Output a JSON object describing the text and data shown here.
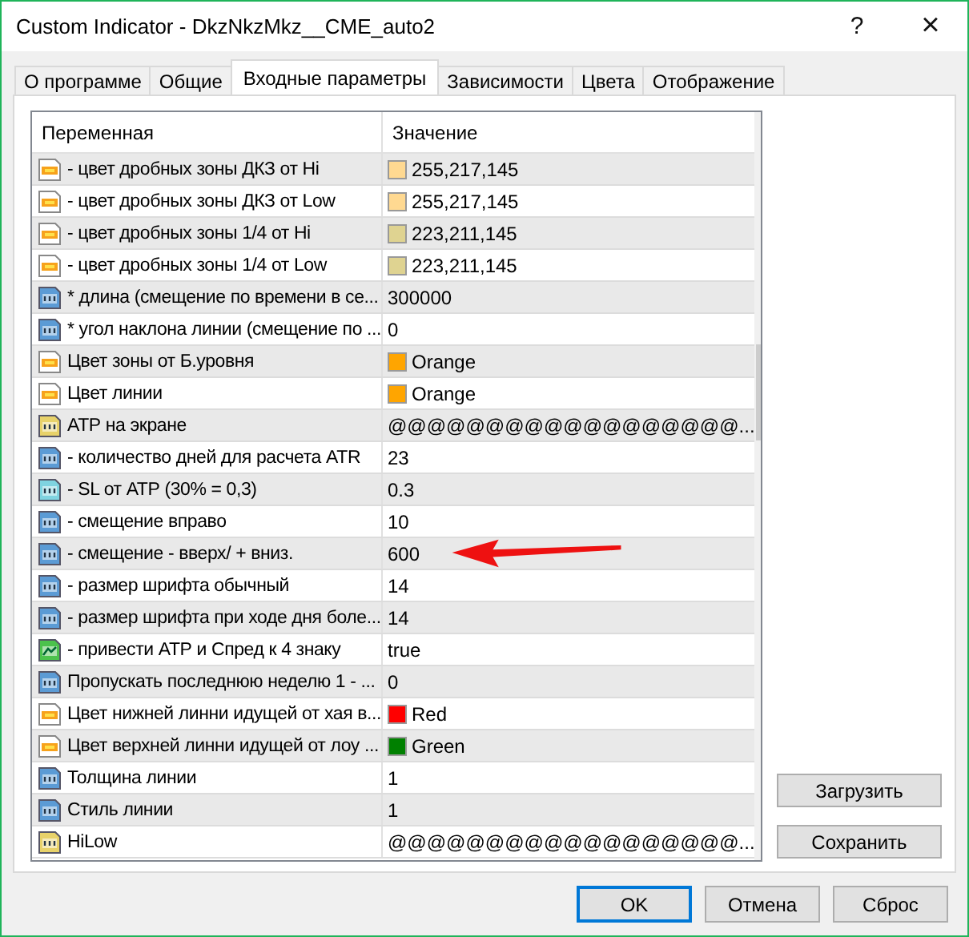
{
  "window": {
    "title": "Custom Indicator - DkzNkzMkz__CME_auto2",
    "help": "?",
    "close": "×"
  },
  "tabs": [
    {
      "label": "О программе",
      "selected": false
    },
    {
      "label": "Общие",
      "selected": false
    },
    {
      "label": "Входные параметры",
      "selected": true
    },
    {
      "label": "Зависимости",
      "selected": false
    },
    {
      "label": "Цвета",
      "selected": false
    },
    {
      "label": "Отображение",
      "selected": false
    }
  ],
  "table": {
    "columns": [
      "Переменная",
      "Значение"
    ],
    "rows": [
      {
        "kind": "color",
        "name": "- цвет дробных зоны ДКЗ от Hi",
        "value": "255,217,145",
        "color": "#ffd991",
        "marked": false
      },
      {
        "kind": "color",
        "name": "- цвет дробных зоны ДКЗ от Low",
        "value": "255,217,145",
        "color": "#ffd991",
        "marked": false
      },
      {
        "kind": "color",
        "name": "- цвет дробных зоны 1/4 от Hi",
        "value": "223,211,145",
        "color": "#dfd391",
        "marked": false
      },
      {
        "kind": "color",
        "name": "- цвет дробных зоны 1/4 от Low",
        "value": "223,211,145",
        "color": "#dfd391",
        "marked": false
      },
      {
        "kind": "int",
        "name": "* длина (смещение по времени в се...",
        "value": "300000",
        "marked": false
      },
      {
        "kind": "int",
        "name": "* угол наклона линии (смещение по ...",
        "value": "0",
        "marked": false
      },
      {
        "kind": "color",
        "name": "Цвет зоны от Б.уровня",
        "value": "Orange",
        "color": "#ffa500",
        "marked": false
      },
      {
        "kind": "color",
        "name": "Цвет линии",
        "value": "Orange",
        "color": "#ffa500",
        "marked": false
      },
      {
        "kind": "string",
        "name": "АТР на экране",
        "value": "@@@@@@@@@@@@@@@@@@...",
        "marked": false
      },
      {
        "kind": "int",
        "name": "- количество дней для расчета ATR",
        "value": "23",
        "marked": false
      },
      {
        "kind": "double",
        "name": "- SL от АТР (30% = 0,3)",
        "value": "0.3",
        "marked": false
      },
      {
        "kind": "int",
        "name": "- смещение вправо",
        "value": "10",
        "marked": false
      },
      {
        "kind": "int",
        "name": "- смещение - вверх/ + вниз.",
        "value": "600",
        "marked": true
      },
      {
        "kind": "int",
        "name": "- размер шрифта обычный",
        "value": "14",
        "marked": false
      },
      {
        "kind": "int",
        "name": "- размер шрифта при ходе дня боле...",
        "value": "14",
        "marked": false
      },
      {
        "kind": "bool",
        "name": "- привести АТР и Спред к 4 знаку",
        "value": "true",
        "marked": false
      },
      {
        "kind": "int",
        "name": "Пропускать последнюю неделю 1 - ...",
        "value": "0",
        "marked": false
      },
      {
        "kind": "color",
        "name": "Цвет нижней линни идущей от хая в...",
        "value": "Red",
        "color": "#ff0000",
        "marked": false
      },
      {
        "kind": "color",
        "name": "Цвет верхней линни идущей от лоу ...",
        "value": "Green",
        "color": "#008000",
        "marked": false
      },
      {
        "kind": "int",
        "name": "Толщина линии",
        "value": "1",
        "marked": false
      },
      {
        "kind": "int",
        "name": "Стиль линии",
        "value": "1",
        "marked": false
      },
      {
        "kind": "string",
        "name": "HiLow",
        "value": "@@@@@@@@@@@@@@@@@@...",
        "marked": false
      }
    ]
  },
  "side_buttons": [
    "Загрузить",
    "Сохранить"
  ],
  "buttons": [
    {
      "label": "OK",
      "selected": true
    },
    {
      "label": "Отмена",
      "selected": false
    },
    {
      "label": "Сброс",
      "selected": false
    }
  ]
}
